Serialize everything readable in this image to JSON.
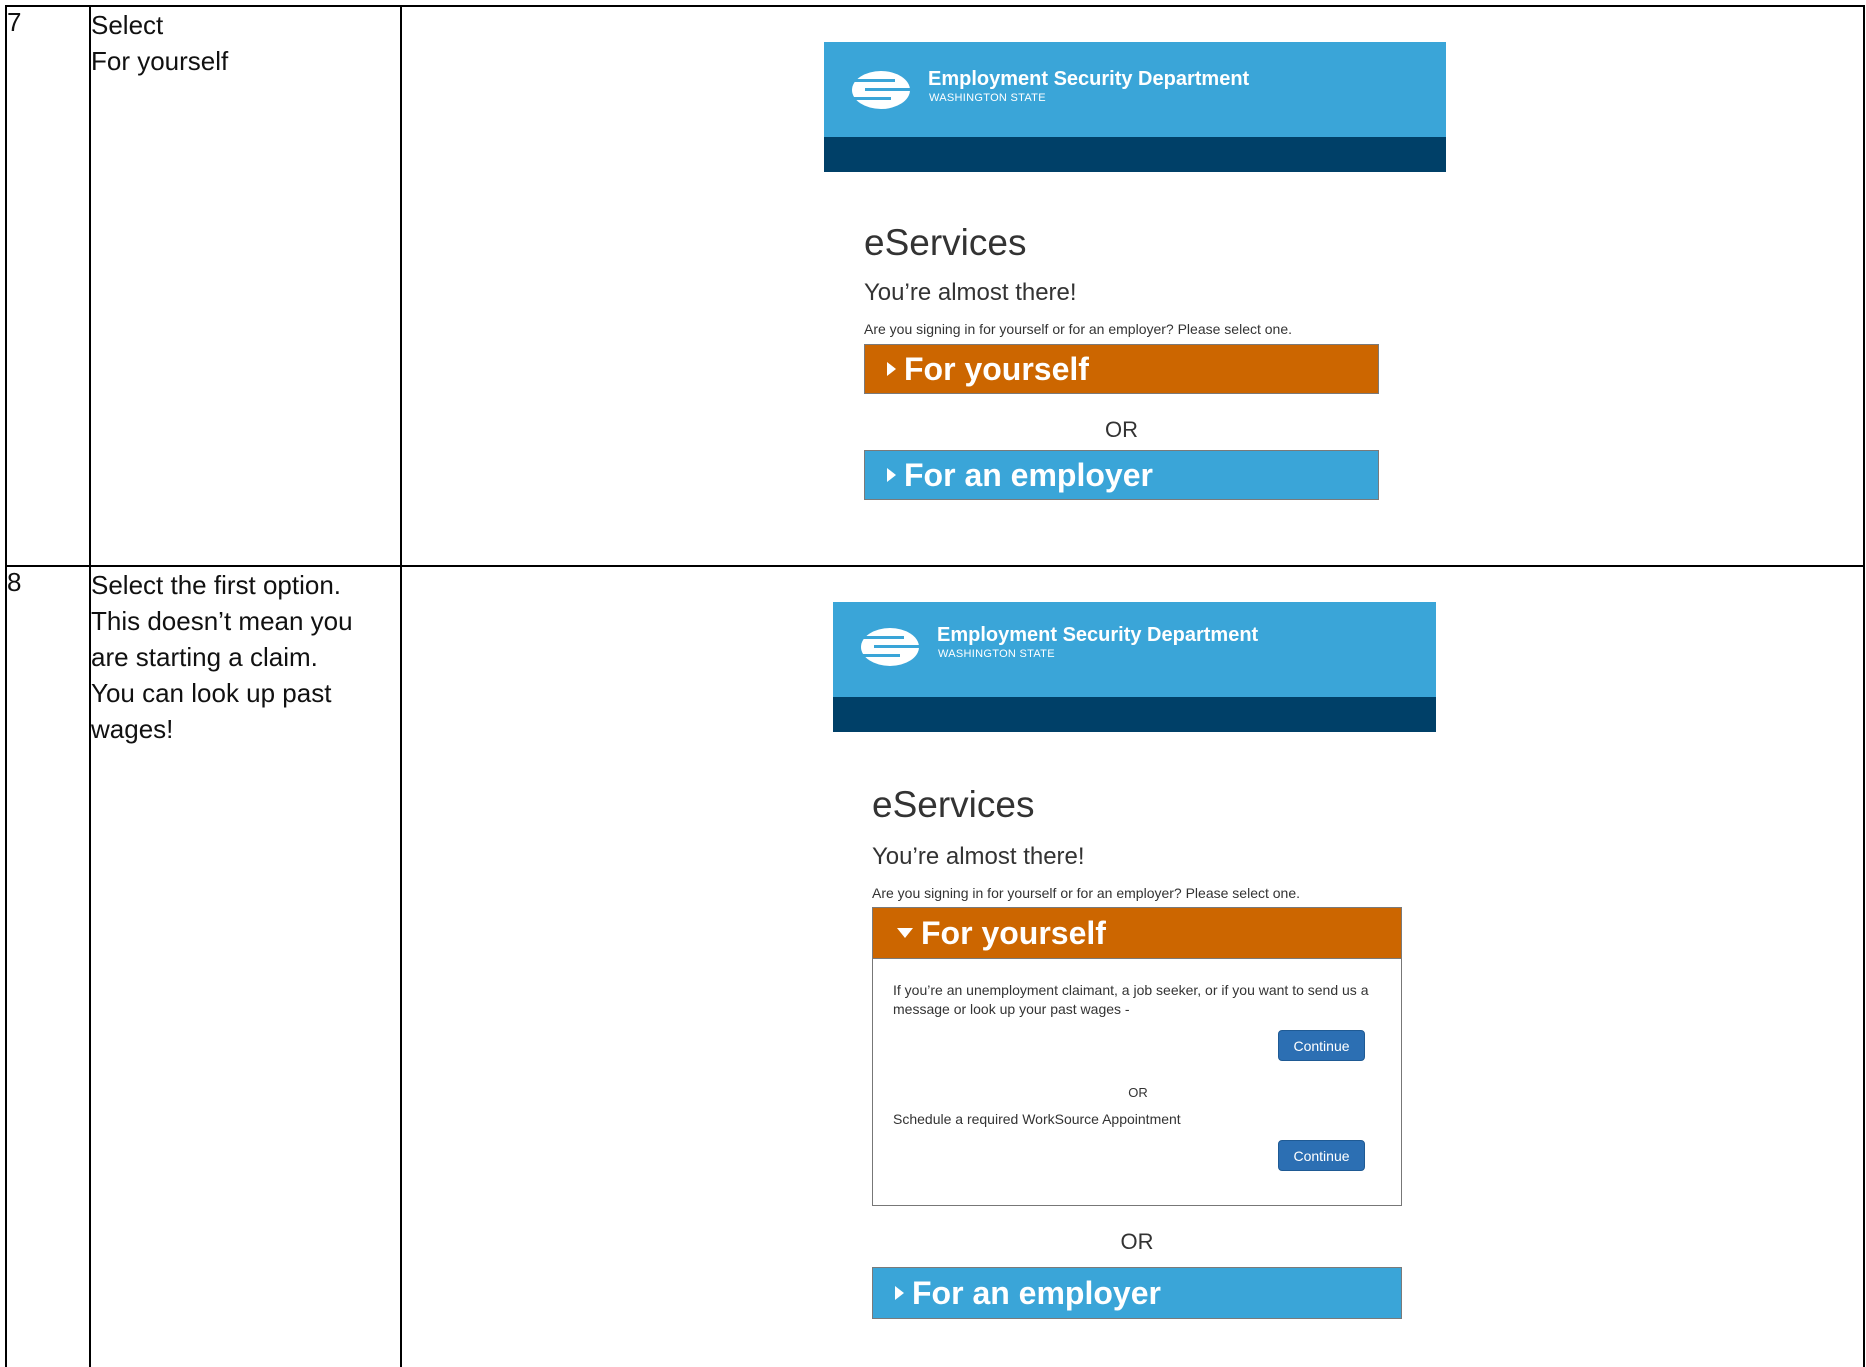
{
  "steps": [
    {
      "number": "7",
      "instruction_lines": [
        "Select",
        "For yourself"
      ],
      "screenshot": {
        "org_name": "Employment Security Department",
        "org_sub": "WASHINGTON STATE",
        "title": "eServices",
        "subtitle": "You’re almost there!",
        "question": "Are you signing in for yourself or for an employer? Please select one.",
        "option_yourself": "For yourself",
        "or_label": "OR",
        "option_employer": "For an employer"
      }
    },
    {
      "number": "8",
      "instruction_lines": [
        "Select the first option.",
        "This doesn’t mean you",
        "are starting a claim.",
        "You can look up past",
        "wages!"
      ],
      "screenshot": {
        "org_name": "Employment Security Department",
        "org_sub": "WASHINGTON STATE",
        "title": "eServices",
        "subtitle": "You’re almost there!",
        "question": "Are you signing in for yourself or for an employer? Please select one.",
        "option_yourself": "For yourself",
        "panel_text_1": "If you’re an unemployment claimant, a job seeker, or if you want to send us a message or look up your past wages -",
        "continue_1": "Continue",
        "panel_or": "OR",
        "panel_text_2": "Schedule a required WorkSource Appointment",
        "continue_2": "Continue",
        "or_label": "OR",
        "option_employer": "For an employer"
      }
    }
  ],
  "colors": {
    "header_blue": "#3aa5d8",
    "header_navy": "#004068",
    "yourself_orange": "#cc6600",
    "continue_blue": "#2c6fb3"
  },
  "icons": [
    "esd-logo-icon",
    "caret-right-icon",
    "caret-down-icon"
  ]
}
